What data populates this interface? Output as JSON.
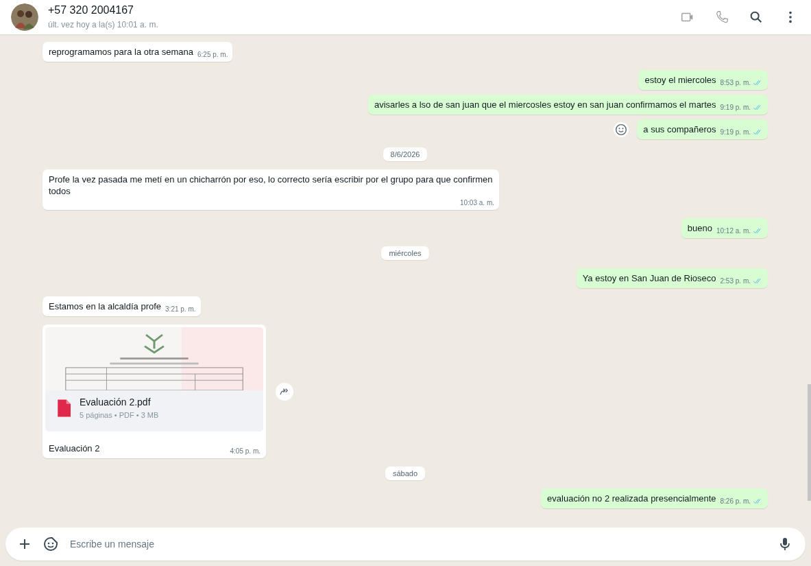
{
  "header": {
    "contact_name": "+57 320 2004167",
    "last_seen": "últ. vez hoy a la(s) 10:01 a. m."
  },
  "messages": [
    {
      "kind": "in",
      "text": "reprogramamos para la otra semana",
      "time": "6:25 p. m."
    },
    {
      "kind": "out",
      "text": "estoy el miercoles",
      "time": "8:53 p. m.",
      "read": true
    },
    {
      "kind": "out",
      "text": "avisarles a lso de san juan que el miercosles estoy en san juan confirmamos el martes",
      "time": "9:19 p. m.",
      "read": true
    },
    {
      "kind": "out",
      "text": "a sus compañeros",
      "time": "9:19 p. m.",
      "read": true,
      "reaction_button": true
    },
    {
      "kind": "date",
      "text": "8/6/2026"
    },
    {
      "kind": "in",
      "text": "Profe la vez pasada me metí en un chicharrón por eso, lo correcto sería escribir por el grupo para que confirmen todos",
      "time": "10:03 a. m."
    },
    {
      "kind": "out",
      "text": "bueno",
      "time": "10:12 a. m.",
      "read": true
    },
    {
      "kind": "date",
      "text": "miércoles"
    },
    {
      "kind": "out",
      "text": "Ya estoy en San Juan de Rioseco",
      "time": "2:53 p. m.",
      "read": true
    },
    {
      "kind": "in",
      "text": "Estamos en la alcaldía profe",
      "time": "3:21 p. m."
    },
    {
      "kind": "document",
      "file_name": "Evaluación 2.pdf",
      "file_info": "5 páginas • PDF • 3 MB",
      "caption": "Evaluación 2",
      "time": "4:05 p. m."
    },
    {
      "kind": "date",
      "text": "sábado"
    },
    {
      "kind": "out",
      "text": "evaluación no 2 realizada presencialmente",
      "time": "8:26 p. m.",
      "read": true
    }
  ],
  "composer": {
    "placeholder": "Escribe un mensaje"
  }
}
